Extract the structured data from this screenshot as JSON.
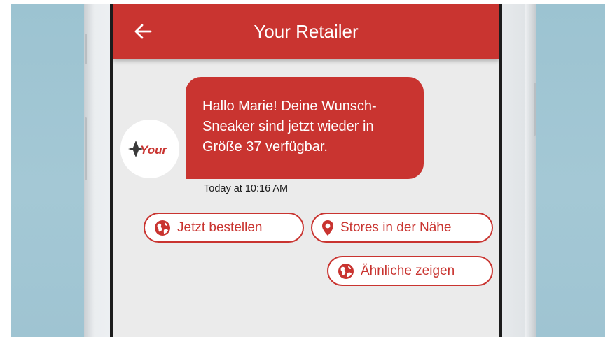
{
  "app": {
    "title": "Your Retailer",
    "accent_color": "#c93430",
    "back_icon": "arrow-left-icon"
  },
  "conversation": {
    "sender_logo_text": "Your",
    "message": {
      "line1": "Hallo Marie! Deine Wunsch-",
      "line2": "Sneaker sind jetzt wieder in",
      "line3": "Größe 37 verfügbar."
    },
    "timestamp": "Today at 10:16 AM"
  },
  "quick_replies": [
    {
      "label": "Jetzt bestellen",
      "icon": "globe-icon"
    },
    {
      "label": "Stores in der Nähe",
      "icon": "map-pin-icon"
    },
    {
      "label": "Ähnliche zeigen",
      "icon": "globe-icon"
    }
  ]
}
